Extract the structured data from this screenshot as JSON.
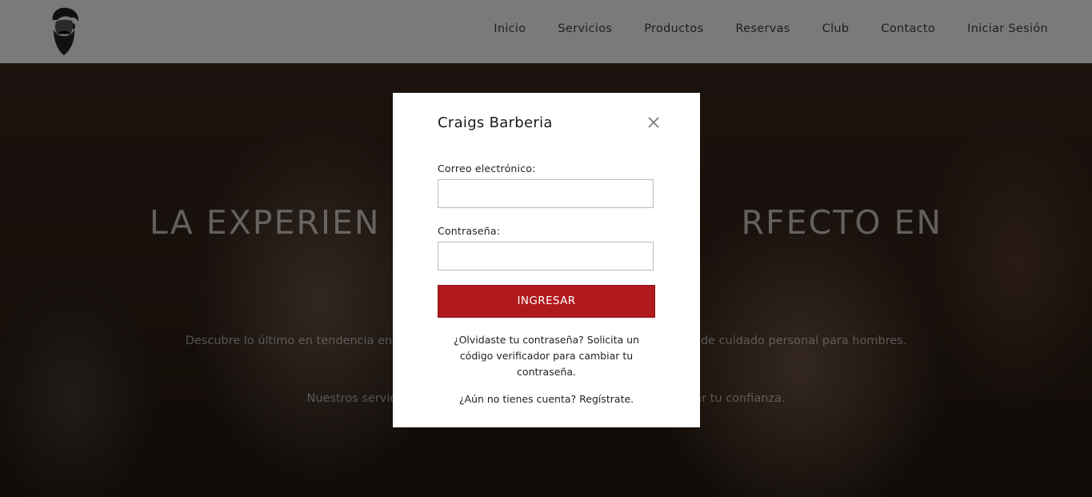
{
  "header": {
    "logo_icon": "bearded-man-logo-icon",
    "nav": [
      {
        "label": "Inicio"
      },
      {
        "label": "Servicios"
      },
      {
        "label": "Productos"
      },
      {
        "label": "Reservas"
      },
      {
        "label": "Club"
      },
      {
        "label": "Contacto"
      },
      {
        "label": "Iniciar Sesión"
      }
    ]
  },
  "hero": {
    "title_visible": "LA EXPERIEN                              RFECTO EN",
    "text_line1": "Descubre lo último en tendencia en c                                                                              a de cuidado personal para hombres.",
    "text_line2": "Nuestros servicios                                                                        alzar tu confianza."
  },
  "modal": {
    "title": "Craigs Barberia",
    "close_icon": "close-icon",
    "email_label": "Correo electrónico:",
    "email_value": "",
    "password_label": "Contraseña:",
    "password_value": "",
    "submit_label": "INGRESAR",
    "forgot_text": "¿Olvidaste tu contraseña? Solicita un código verificador para cambiar tu contraseña.",
    "register_text": "¿Aún no tienes cuenta? Regístrate."
  },
  "colors": {
    "header_bg": "#7a7a7a",
    "accent": "#b0191d",
    "modal_bg": "#ffffff"
  }
}
